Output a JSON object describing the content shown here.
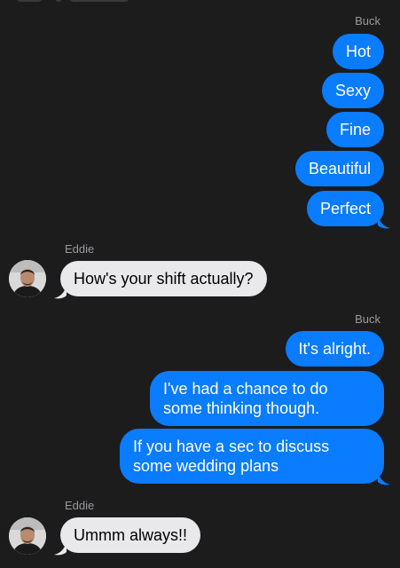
{
  "theme": {
    "background": "#1c1c1c",
    "outgoing_bubble": "#0a7cff",
    "incoming_bubble": "#e9e9eb",
    "sender_label": "#9a9a9e"
  },
  "conversation": {
    "groups": [
      {
        "sender": "Buck",
        "direction": "outgoing",
        "messages": [
          "Hot",
          "Sexy",
          "Fine",
          "Beautiful",
          "Perfect"
        ]
      },
      {
        "sender": "Eddie",
        "direction": "incoming",
        "avatar_icon": "person-photo-avatar",
        "messages": [
          "How's your shift actually?"
        ]
      },
      {
        "sender": "Buck",
        "direction": "outgoing",
        "messages": [
          "It's alright.",
          "I've had a chance to do some thinking though.",
          "If you have a sec to discuss some wedding plans"
        ]
      },
      {
        "sender": "Eddie",
        "direction": "incoming",
        "avatar_icon": "person-photo-avatar",
        "messages": [
          "Ummm always!!"
        ]
      }
    ]
  }
}
